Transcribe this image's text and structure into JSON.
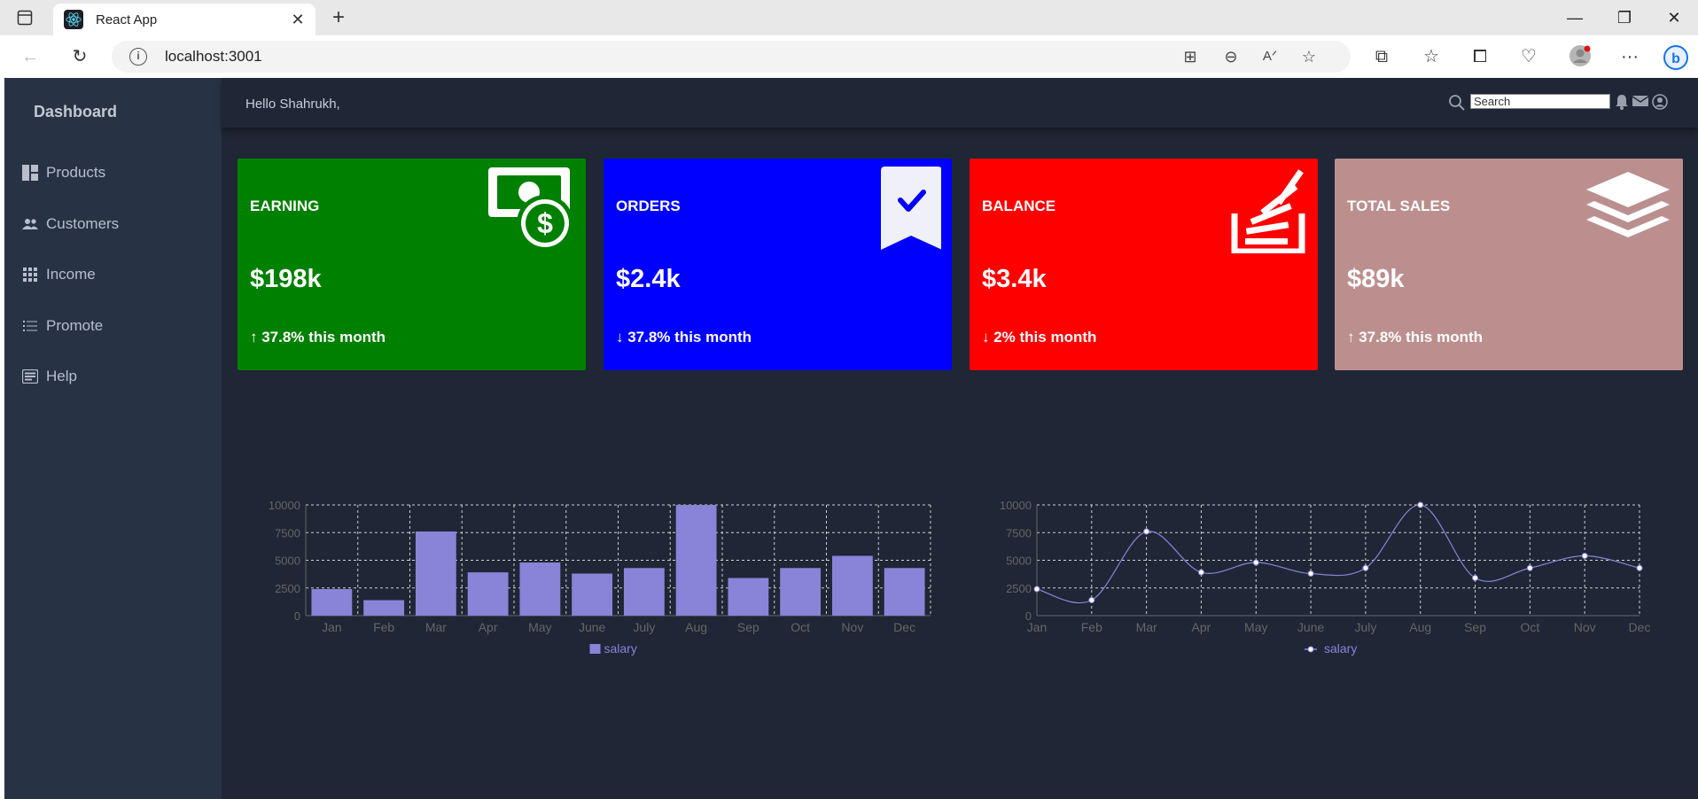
{
  "browser": {
    "tab_title": "React App",
    "url": "localhost:3001"
  },
  "sidebar": {
    "brand": "Dashboard",
    "items": [
      {
        "label": "Products",
        "icon": "dashboard-icon"
      },
      {
        "label": "Customers",
        "icon": "users-icon"
      },
      {
        "label": "Income",
        "icon": "grid-icon"
      },
      {
        "label": "Promote",
        "icon": "list-icon"
      },
      {
        "label": "Help",
        "icon": "help-icon"
      }
    ]
  },
  "header": {
    "greeting": "Hello Shahrukh,",
    "search_placeholder": "Search"
  },
  "cards": [
    {
      "title": "EARNING",
      "value": "$198k",
      "change": "↑ 37.8% this month",
      "color": "#008000",
      "icon": "money-icon"
    },
    {
      "title": "ORDERS",
      "value": "$2.4k",
      "change": "↓ 37.8% this month",
      "color": "#0000ff",
      "icon": "bookmark-check-icon"
    },
    {
      "title": "BALANCE",
      "value": "$3.4k",
      "change": "↓ 2% this month",
      "color": "#ff0000",
      "icon": "stack-overflow-icon"
    },
    {
      "title": "TOTAL SALES",
      "value": "$89k",
      "change": "↑ 37.8% this month",
      "color": "#bc8f8f",
      "icon": "layers-icon"
    }
  ],
  "chart_data": [
    {
      "type": "bar",
      "categories": [
        "Jan",
        "Feb",
        "Mar",
        "Apr",
        "May",
        "June",
        "July",
        "Aug",
        "Sep",
        "Oct",
        "Nov",
        "Dec"
      ],
      "series": [
        {
          "name": "salary",
          "values": [
            2400,
            1398,
            7600,
            3908,
            4800,
            3800,
            4300,
            10000,
            3400,
            4300,
            5400,
            4300
          ]
        }
      ],
      "ylim": [
        0,
        10000
      ],
      "yticks": [
        0,
        2500,
        5000,
        7500,
        10000
      ],
      "grid": true,
      "legend": "bottom",
      "color": "#8884d8"
    },
    {
      "type": "line",
      "categories": [
        "Jan",
        "Feb",
        "Mar",
        "Apr",
        "May",
        "June",
        "July",
        "Aug",
        "Sep",
        "Oct",
        "Nov",
        "Dec"
      ],
      "series": [
        {
          "name": "salary",
          "values": [
            2400,
            1398,
            7600,
            3908,
            4800,
            3800,
            4300,
            10000,
            3400,
            4300,
            5400,
            4300
          ]
        }
      ],
      "ylim": [
        0,
        10000
      ],
      "yticks": [
        0,
        2500,
        5000,
        7500,
        10000
      ],
      "grid": true,
      "legend": "bottom",
      "color": "#8884d8"
    }
  ]
}
